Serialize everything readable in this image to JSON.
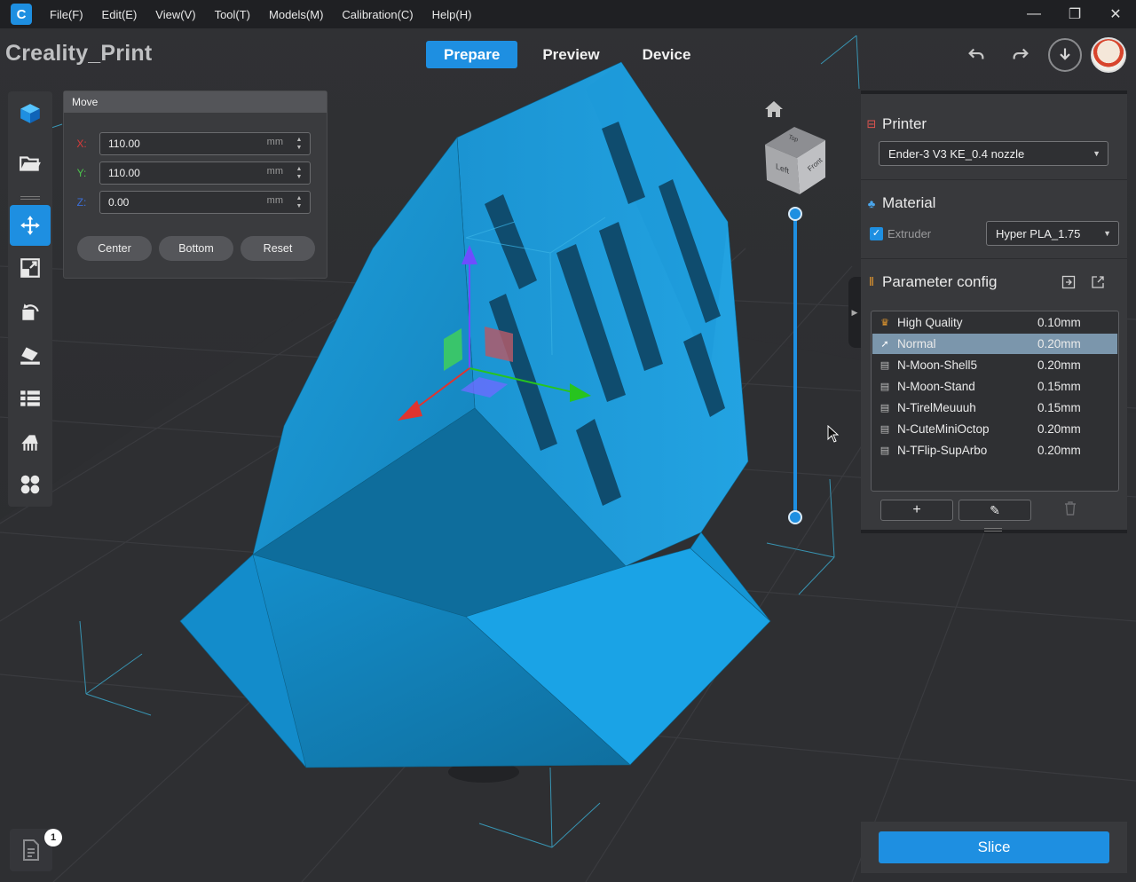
{
  "app": {
    "title": "Creality_Print",
    "menu": [
      "File(F)",
      "Edit(E)",
      "View(V)",
      "Tool(T)",
      "Models(M)",
      "Calibration(C)",
      "Help(H)"
    ],
    "window_controls": {
      "minimize": "—",
      "restore": "❐",
      "close": "✕"
    }
  },
  "tabs": [
    {
      "label": "Prepare",
      "active": true
    },
    {
      "label": "Preview",
      "active": false
    },
    {
      "label": "Device",
      "active": false
    }
  ],
  "header_icons": {
    "undo": "undo-icon",
    "redo": "redo-icon",
    "download": "download-icon",
    "avatar": "avatar"
  },
  "toolbar": {
    "items": [
      {
        "name": "cube-icon",
        "active": false
      },
      {
        "name": "open-folder-icon",
        "active": false
      },
      {
        "name": "move-icon",
        "active": true
      },
      {
        "name": "scale-icon",
        "active": false
      },
      {
        "name": "rotate-icon",
        "active": false
      },
      {
        "name": "lay-flat-icon",
        "active": false
      },
      {
        "name": "list-icon",
        "active": false
      },
      {
        "name": "support-icon",
        "active": false
      },
      {
        "name": "arrange-icon",
        "active": false
      }
    ]
  },
  "move_panel": {
    "title": "Move",
    "fields": [
      {
        "axis": "X:",
        "value": "110.00",
        "unit": "mm",
        "color": "#d83a3a"
      },
      {
        "axis": "Y:",
        "value": "110.00",
        "unit": "mm",
        "color": "#4cc34c"
      },
      {
        "axis": "Z:",
        "value": "0.00",
        "unit": "mm",
        "color": "#3b6fd8"
      }
    ],
    "buttons": {
      "center": "Center",
      "bottom": "Bottom",
      "reset": "Reset"
    }
  },
  "view_cube": {
    "face_left": "Left",
    "face_front": "Front",
    "face_top": "Top"
  },
  "printer": {
    "section_title": "Printer",
    "selected": "Ender-3 V3 KE_0.4 nozzle"
  },
  "material": {
    "section_title": "Material",
    "extruder_label": "Extruder",
    "extruder_checked": true,
    "selected": "Hyper PLA_1.75"
  },
  "parameter_config": {
    "section_title": "Parameter config",
    "presets": [
      {
        "icon": "crown-icon",
        "name": "High Quality",
        "value": "0.10mm",
        "selected": false
      },
      {
        "icon": "rocket-icon",
        "name": "Normal",
        "value": "0.20mm",
        "selected": true
      },
      {
        "icon": "file-icon",
        "name": "N-Moon-Shell5",
        "value": "0.20mm",
        "selected": false
      },
      {
        "icon": "file-icon",
        "name": "N-Moon-Stand",
        "value": "0.15mm",
        "selected": false
      },
      {
        "icon": "file-icon",
        "name": "N-TirelMeuuuh",
        "value": "0.15mm",
        "selected": false
      },
      {
        "icon": "file-icon",
        "name": "N-CuteMiniOctop",
        "value": "0.20mm",
        "selected": false
      },
      {
        "icon": "file-icon",
        "name": "N-TFlip-SupArbo",
        "value": "0.20mm",
        "selected": false
      }
    ],
    "buttons": {
      "add": "+",
      "edit": "✎",
      "delete": "🗑"
    }
  },
  "slice": {
    "label": "Slice"
  },
  "objects_badge": {
    "count": "1"
  },
  "colors": {
    "accent": "#1e8fe1",
    "model": "#1a9ad8",
    "bg": "#2c2d30"
  }
}
